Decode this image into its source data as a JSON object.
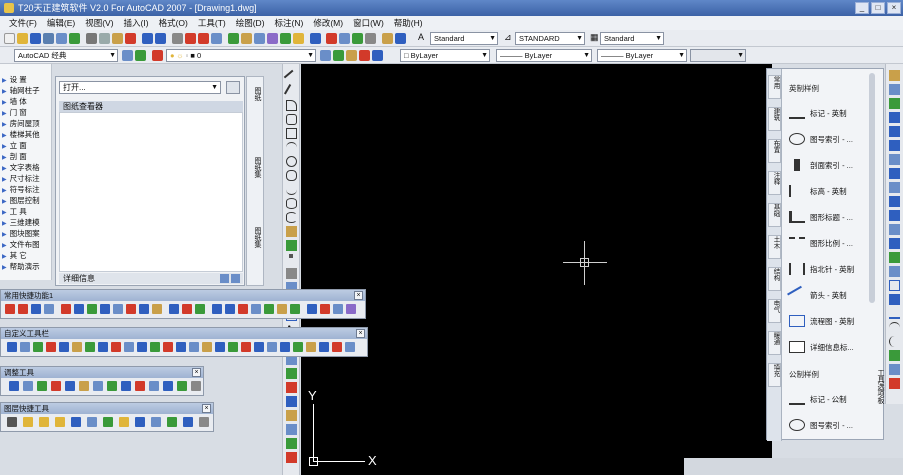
{
  "window": {
    "title": "T20天正建筑软件 V2.0 For AutoCAD 2007 - [Drawing1.dwg]",
    "buttons": [
      "_",
      "□",
      "×"
    ]
  },
  "menu": [
    "文件(F)",
    "编辑(E)",
    "视图(V)",
    "插入(I)",
    "格式(O)",
    "工具(T)",
    "绘图(D)",
    "标注(N)",
    "修改(M)",
    "窗口(W)",
    "帮助(H)"
  ],
  "toolbar2": {
    "workspace": "AutoCAD 经典",
    "layer": "0",
    "text_style": "Standard",
    "dim_style": "STANDARD",
    "table_style": "Standard"
  },
  "properties_bar": {
    "color": "ByLayer",
    "linetype": "ByLayer",
    "lineweight": "ByLayer"
  },
  "left_menu": [
    "设  置",
    "轴网柱子",
    "墙  体",
    "门  窗",
    "房间屋顶",
    "楼梯其他",
    "立  面",
    "剖  面",
    "文字表格",
    "尺寸标注",
    "符号标注",
    "图层控制",
    "工  具",
    "三维建模",
    "图块图案",
    "文件布图",
    "其  它",
    "帮助演示"
  ],
  "sheet_panel": {
    "open_combo": "打开...",
    "header": "图纸查看器",
    "footer": "详细信息"
  },
  "vert_tabs": [
    "图纸",
    "图纸集",
    "图纸集"
  ],
  "float_toolbars": [
    {
      "title": "常用快捷功能1",
      "close": "×"
    },
    {
      "title": "自定义工具栏",
      "close": "×"
    },
    {
      "title": "调整工具",
      "close": "×"
    },
    {
      "title": "图层快捷工具",
      "close": "×"
    }
  ],
  "tool_palette": {
    "tabs": [
      "常用",
      "建筑",
      "布置",
      "注释",
      "基础",
      "土木",
      "结构",
      "电气",
      "暖通",
      "填充"
    ],
    "sections": [
      "英制样例",
      "公制样例"
    ],
    "items": [
      "标记 - 英制",
      "图号索引 - ...",
      "剖面索引 - ...",
      "标高 - 英制",
      "图形标题 - ...",
      "图形比例 - ...",
      "指北针 - 英制",
      "箭头 - 英制",
      "流程图 - 英制",
      "详细信息标...",
      "标记 - 公制",
      "图号索引 - ..."
    ],
    "side_label": "工具选项板"
  },
  "ucs": {
    "x_label": "X",
    "y_label": "Y"
  },
  "colors": {
    "canvas": "#000000",
    "title_bar": "#4a70b4",
    "icon_blue": "#2f5fbf",
    "icon_red": "#d23a2a",
    "icon_green": "#3a9a3a",
    "icon_yellow": "#e0b53a"
  }
}
